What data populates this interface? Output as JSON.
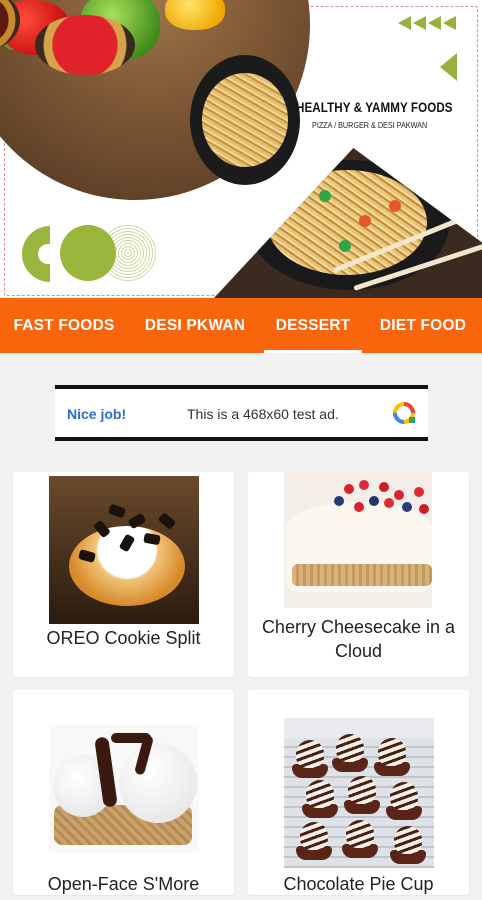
{
  "header": {
    "brand_title": "HEALTHY & YAMMY FOODS",
    "brand_subtitle": "PIZZA / BURGER & DESI PAKWAN",
    "accent_color": "#96b23c"
  },
  "tabs": [
    {
      "label": "FAST FOODS",
      "active": false
    },
    {
      "label": "DESI PKWAN",
      "active": false
    },
    {
      "label": "DESSERT",
      "active": true
    },
    {
      "label": "DIET FOOD",
      "active": false
    }
  ],
  "tabbar_color": "#f8650d",
  "ad": {
    "badge": "Nice job!",
    "text": "This is a 468x60 test ad.",
    "icon": "ad-logo-icon"
  },
  "items": [
    {
      "title": "OREO Cookie Split",
      "image": "oreo-cookie-split-image"
    },
    {
      "title": "Cherry Cheesecake in a Cloud",
      "image": "cherry-cheesecake-image"
    },
    {
      "title": "Open-Face S'More",
      "image": "open-face-smore-image"
    },
    {
      "title": "Chocolate Pie Cup",
      "image": "chocolate-pie-cup-image"
    }
  ]
}
